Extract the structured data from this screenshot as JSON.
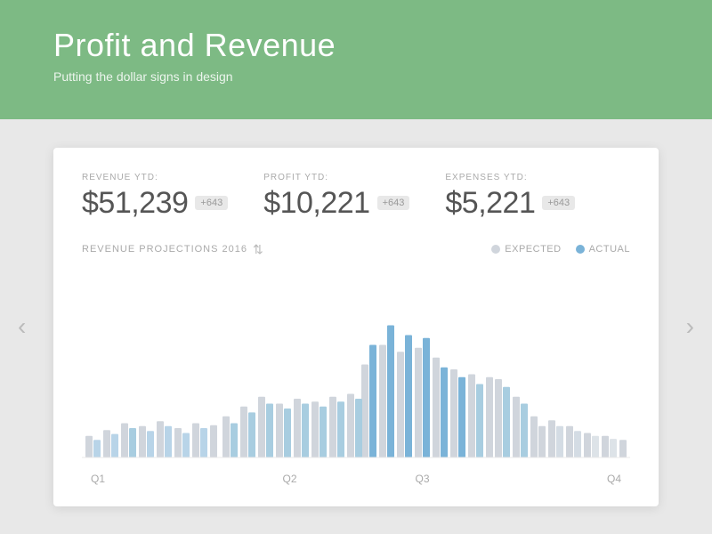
{
  "header": {
    "title": "Profit and Revenue",
    "subtitle": "Putting the dollar signs in design"
  },
  "metrics": [
    {
      "label": "REVENUE YTD:",
      "value": "$51,239",
      "badge": "+643"
    },
    {
      "label": "PROFIT YTD:",
      "value": "$10,221",
      "badge": "+643"
    },
    {
      "label": "EXPENSES YTD:",
      "value": "$5,221",
      "badge": "+643"
    }
  ],
  "chart": {
    "title": "REVENUE PROJECTIONS 2016",
    "legend": {
      "expected": "EXPECTED",
      "actual": "ACTUAL"
    },
    "quarters": [
      "Q1",
      "Q2",
      "Q3",
      "Q4"
    ]
  },
  "navigation": {
    "left_arrow": "‹",
    "right_arrow": "›"
  }
}
